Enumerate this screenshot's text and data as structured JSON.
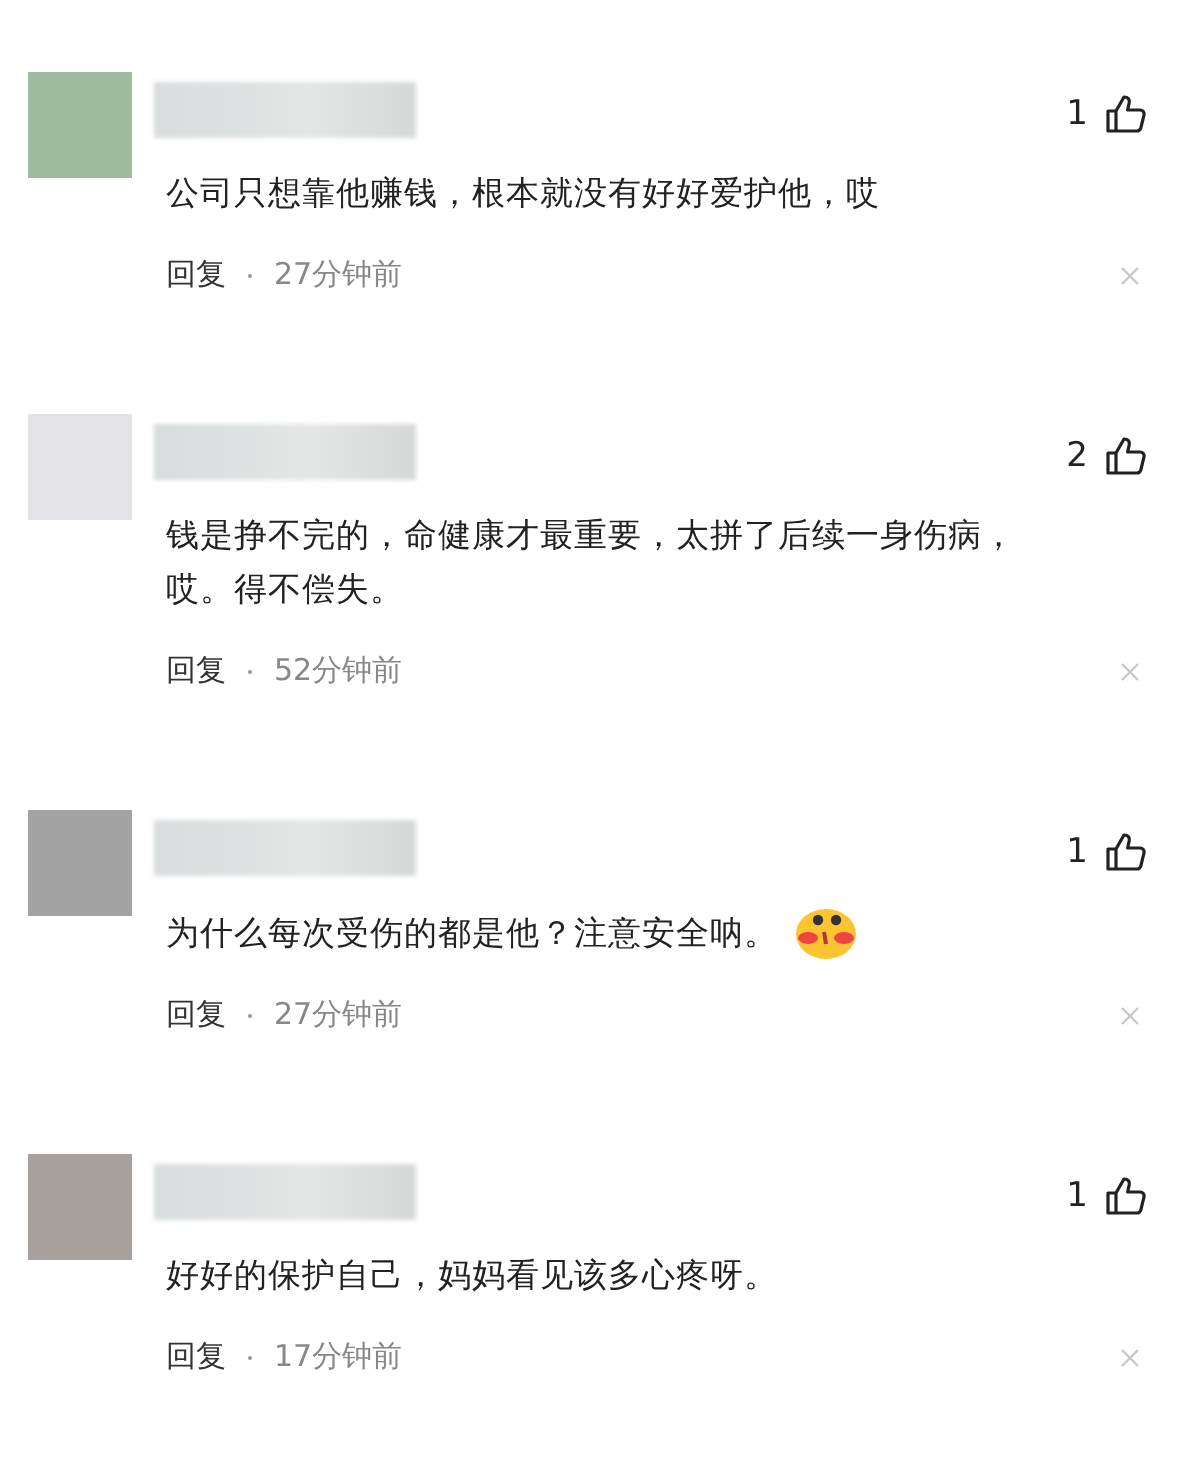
{
  "comments": [
    {
      "color": "#9fbb9f",
      "likes": "1",
      "text": "公司只想靠他赚钱，根本就没有好好爱护他，哎",
      "sticker": false,
      "reply": "回复",
      "time": "27分钟前"
    },
    {
      "color": "#e4e4e8",
      "likes": "2",
      "text": "钱是挣不完的，命健康才最重要，太拼了后续一身伤病，哎。得不偿失。",
      "sticker": false,
      "reply": "回复",
      "time": "52分钟前"
    },
    {
      "color": "#a3a3a3",
      "likes": "1",
      "text": "为什么每次受伤的都是他？注意安全呐。",
      "sticker": true,
      "reply": "回复",
      "time": "27分钟前"
    },
    {
      "color": "#a8a19e",
      "likes": "1",
      "text": "好好的保护自己，妈妈看见该多心疼呀。",
      "sticker": false,
      "reply": "回复",
      "time": "17分钟前"
    }
  ]
}
